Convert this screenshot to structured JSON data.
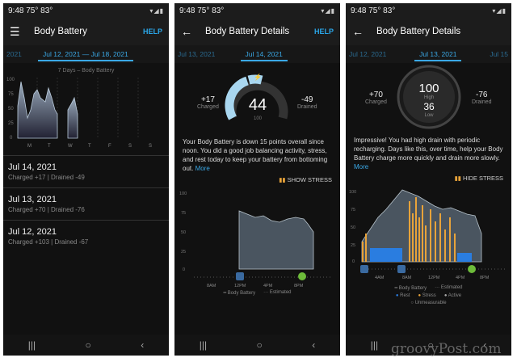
{
  "status": {
    "time": "9:48",
    "temp": "75° 83°"
  },
  "screen1": {
    "title": "Body Battery",
    "help": "HELP",
    "date_left_edge": "2021",
    "date_selected": "Jul 12, 2021 — Jul 18, 2021",
    "chart_title": "7 Days – Body Battery",
    "y_ticks": [
      "100",
      "75",
      "50",
      "25",
      "0"
    ],
    "x_days": [
      "M",
      "T",
      "W",
      "T",
      "F",
      "S",
      "S"
    ],
    "rows": [
      {
        "date": "Jul 14, 2021",
        "summary": "Charged +17 | Drained -49"
      },
      {
        "date": "Jul 13, 2021",
        "summary": "Charged +70 | Drained -76"
      },
      {
        "date": "Jul 12, 2021",
        "summary": "Charged +103 | Drained -67"
      }
    ]
  },
  "screen2": {
    "title": "Body Battery Details",
    "help": "HELP",
    "date_prev": "Jul 13, 2021",
    "date_selected": "Jul 14, 2021",
    "charged_val": "+17",
    "charged_lbl": "Charged",
    "drained_val": "-49",
    "drained_lbl": "Drained",
    "gauge_val": "44",
    "gauge_max": "100",
    "description": "Your Body Battery is down 15 points overall since noon. You did a good job balancing activity, stress, and rest today to keep your battery from bottoming out.",
    "more": "More",
    "toggle": "SHOW STRESS",
    "y_ticks": [
      "100",
      "75",
      "50",
      "25",
      "0"
    ],
    "x_ticks": [
      "8AM",
      "12PM",
      "4PM",
      "8PM"
    ],
    "legend_a": "Body Battery",
    "legend_b": "Estimated"
  },
  "screen3": {
    "title": "Body Battery Details",
    "date_prev": "Jul 12, 2021",
    "date_selected": "Jul 13, 2021",
    "date_next": "Jul 15",
    "charged_val": "+70",
    "charged_lbl": "Charged",
    "drained_val": "-76",
    "drained_lbl": "Drained",
    "high_val": "100",
    "high_lbl": "High",
    "low_val": "36",
    "low_lbl": "Low",
    "description": "Impressive! You had high drain with periodic recharging. Days like this, over time, help your Body Battery charge more quickly and drain more slowly.",
    "more": "More",
    "toggle": "HIDE STRESS",
    "y_ticks": [
      "100",
      "75",
      "50",
      "25",
      "0"
    ],
    "x_ticks": [
      "4AM",
      "8AM",
      "12PM",
      "4PM",
      "8PM"
    ],
    "legend_a": "Body Battery",
    "legend_b": "Estimated",
    "legend_rest": "Rest",
    "legend_stress": "Stress",
    "legend_active": "Active",
    "legend_unmeasurable": "Unmeasurable"
  },
  "chart_data": [
    {
      "type": "area",
      "title": "7 Days – Body Battery",
      "categories": [
        "M",
        "T",
        "W",
        "T",
        "F",
        "S",
        "S"
      ],
      "ylim": [
        0,
        100
      ],
      "series": [
        {
          "values": [
            85,
            70,
            45,
            null,
            null,
            null,
            null
          ]
        }
      ]
    },
    {
      "type": "area",
      "ylim": [
        0,
        100
      ],
      "x": [
        "8AM",
        "12PM",
        "4PM",
        "8PM"
      ],
      "series": [
        {
          "name": "Body Battery",
          "values": [
            76,
            68,
            70,
            52
          ]
        }
      ]
    }
  ],
  "watermark": "groovyPost.com",
  "colors": {
    "accent": "#3aa8e6",
    "stress": "#e8a33a",
    "rest": "#2a7de0"
  }
}
